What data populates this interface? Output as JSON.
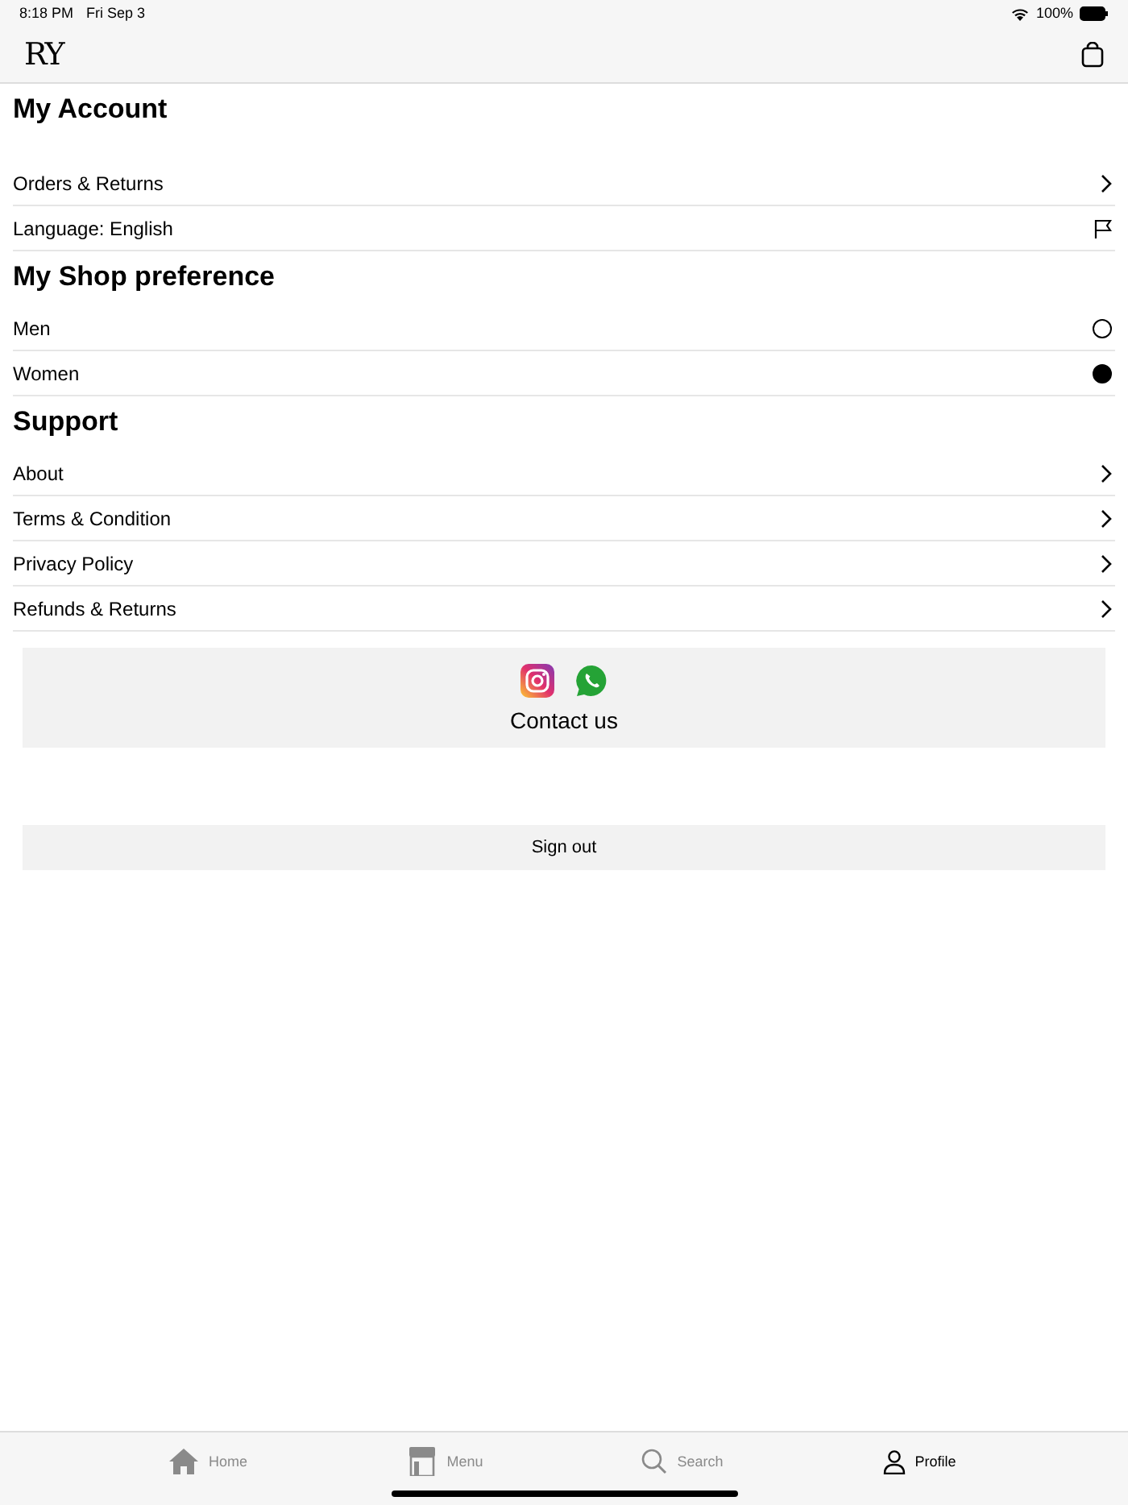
{
  "status_bar": {
    "time": "8:18 PM",
    "date": "Fri Sep 3",
    "battery": "100%"
  },
  "header": {
    "logo": "RY"
  },
  "sections": [
    {
      "title": "My Account",
      "items": [
        {
          "kind": "link",
          "label": "Orders & Returns"
        },
        {
          "kind": "language",
          "label": "Language: English"
        }
      ]
    },
    {
      "title": "My Shop preference",
      "items": [
        {
          "kind": "radio",
          "label": "Men",
          "selected": false
        },
        {
          "kind": "radio",
          "label": "Women",
          "selected": true
        }
      ]
    },
    {
      "title": "Support",
      "items": [
        {
          "kind": "link",
          "label": "About"
        },
        {
          "kind": "link",
          "label": "Terms & Condition"
        },
        {
          "kind": "link",
          "label": "Privacy Policy"
        },
        {
          "kind": "link",
          "label": "Refunds & Returns"
        }
      ]
    }
  ],
  "contact": {
    "label": "Contact us"
  },
  "sign_out": "Sign out",
  "tabs": [
    {
      "kind": "home",
      "label": "Home",
      "selected": false
    },
    {
      "kind": "menu",
      "label": "Menu",
      "selected": false
    },
    {
      "kind": "search",
      "label": "Search",
      "selected": false
    },
    {
      "kind": "profile",
      "label": "Profile",
      "selected": true
    }
  ]
}
